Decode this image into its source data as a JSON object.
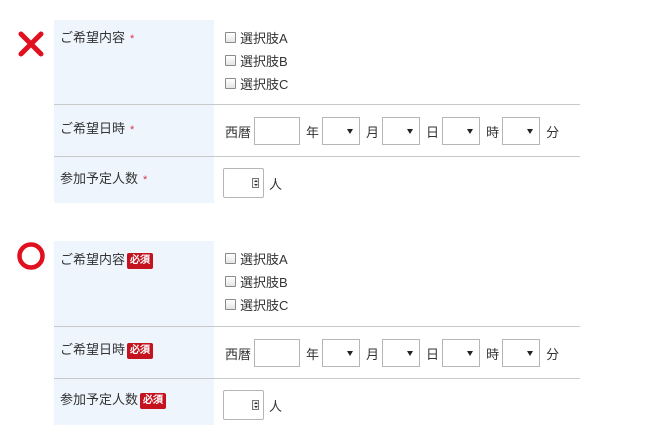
{
  "colors": {
    "header_bg": "#eef5fc",
    "border": "#c9c9c9",
    "incorrect_mark": "#e0101f",
    "correct_mark": "#e0101f",
    "required_star": "#d8364b",
    "required_badge_bg": "#c4121f"
  },
  "marks": {
    "incorrect_icon": "cross-mark-icon",
    "correct_icon": "circle-mark-icon"
  },
  "bad_form": {
    "content_label": "ご希望内容",
    "content_required": "*",
    "options": [
      "選択肢A",
      "選択肢B",
      "選択肢C"
    ],
    "datetime_label": "ご希望日時",
    "datetime_required": "*",
    "people_label": "参加予定人数",
    "people_required": "*"
  },
  "good_form": {
    "content_label": "ご希望内容",
    "content_required": "必須",
    "options": [
      "選択肢A",
      "選択肢B",
      "選択肢C"
    ],
    "datetime_label": "ご希望日時",
    "datetime_required": "必須",
    "people_label": "参加予定人数",
    "people_required": "必須"
  },
  "datetime_fields": {
    "era": "西暦",
    "year": "年",
    "month": "月",
    "day": "日",
    "hour": "時",
    "minute": "分"
  },
  "people_unit": "人"
}
